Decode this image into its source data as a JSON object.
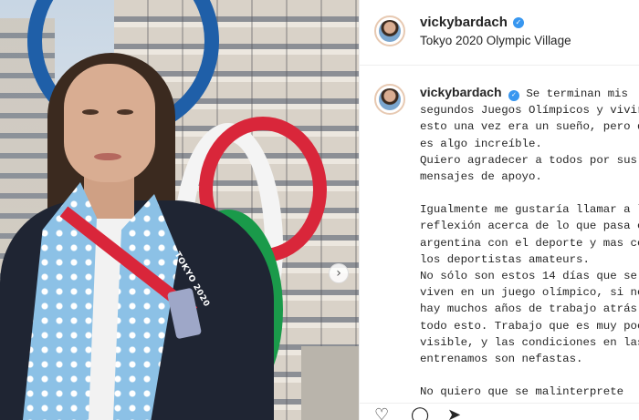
{
  "post": {
    "username": "vickybardach",
    "location": "Tokyo 2020 Olympic Village",
    "verified_badge": "✓"
  },
  "photo": {
    "lanyard_text": "TOKYO 2020",
    "carousel_next_icon": "chevron-right-icon",
    "carousel_next_glyph": "›"
  },
  "caption": {
    "username": "vickybardach",
    "verified_badge": "✓",
    "lines_p1": [
      "Se terminan mis",
      "segundos Juegos Olímpicos y vivir",
      "esto una vez era un sueño, pero dos",
      "es algo increíble."
    ],
    "lines_p2": [
      "Quiero agradecer a todos por sus",
      "mensajes de apoyo."
    ],
    "lines_p3": [
      "Igualmente me gustaría llamar a la",
      "reflexión acerca de lo que pasa en",
      "argentina con el deporte y mas con",
      "los deportistas amateurs.",
      "No sólo son estos 14 días que se",
      "viven en un juego olímpico, si no que",
      "hay muchos años de trabajo atrás de",
      "todo esto. Trabajo que es muy poco",
      "visible, y las condiciones en las que",
      "entrenamos son nefastas."
    ],
    "lines_p4": [
      "No quiero que se malinterprete"
    ]
  },
  "actions": {
    "like_icon": "♡",
    "comment_icon": "◯",
    "share_icon": "➤"
  },
  "colors": {
    "verified": "#3897f0",
    "text": "#262626",
    "ring_blue": "#1f5fa8",
    "ring_red": "#d9263a",
    "ring_green": "#1a9a4a"
  }
}
